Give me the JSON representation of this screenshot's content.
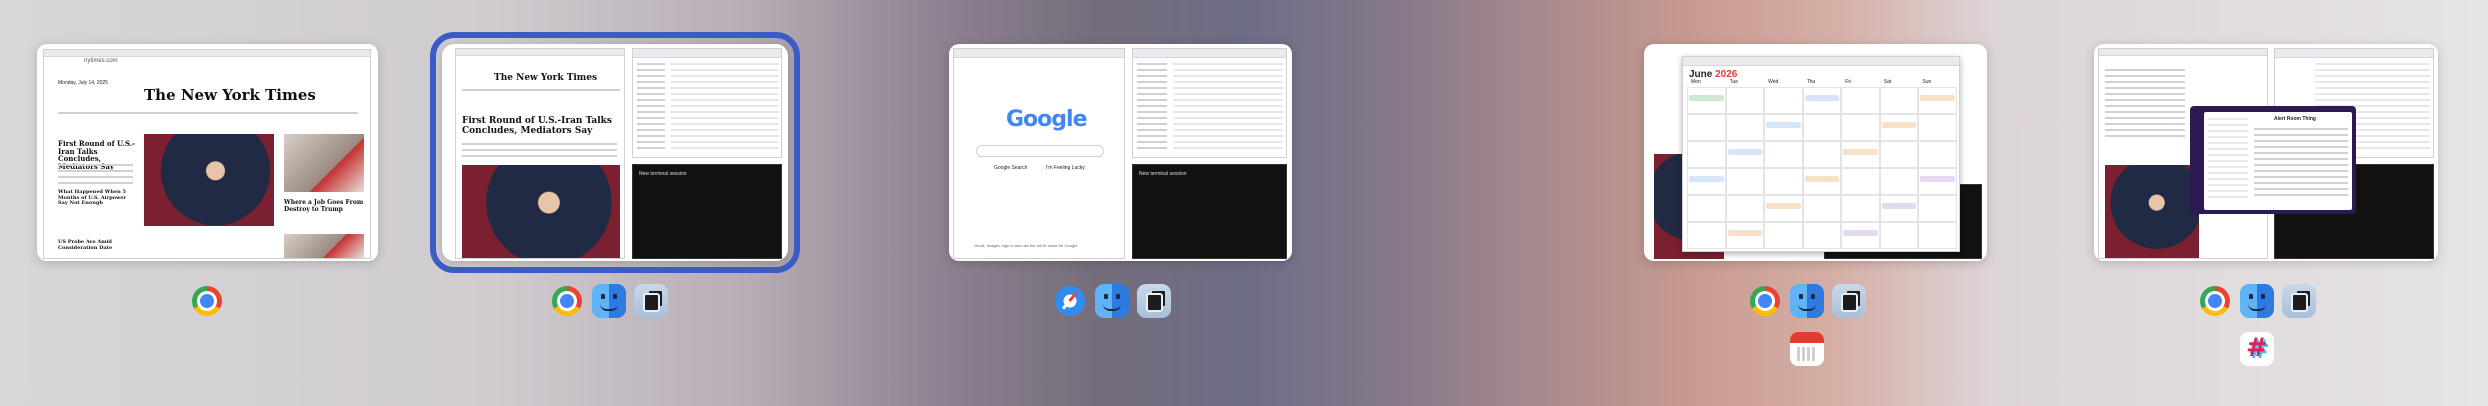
{
  "spaces": [
    {
      "id": "space-1",
      "windows": {
        "nyt_url": "nytimes.com",
        "nyt_date": "Monday, July 14, 2025",
        "nyt_logo": "The New York Times",
        "nyt_headline_1": "First Round of U.S.-Iran Talks Concludes, Mediators Say",
        "nyt_headline_2": "What Happened When 5 Months of U.S. Airpower Say Not Enough",
        "nyt_headline_3": "Where a Job Goes From Destroy to Trump",
        "nyt_headline_4": "US Probe Ave Amid Consideration Date"
      },
      "apps": [
        "chrome-icon"
      ]
    },
    {
      "id": "space-2",
      "selected": true,
      "windows": {
        "nyt_logo": "The New York Times",
        "nyt_headline": "First Round of U.S.-Iran Talks Concludes, Mediators Say",
        "terminal_text": "New terminal session"
      },
      "apps": [
        "chrome-icon",
        "finder-icon",
        "terminal-icon"
      ]
    },
    {
      "id": "space-3",
      "windows": {
        "google_logo": "Google",
        "google_btn_1": "Google Search",
        "google_btn_2": "I'm Feeling Lucky",
        "google_footer": "Gmail, Images; sign in and use the full AI mode for Google",
        "terminal_text": "New terminal session"
      },
      "apps": [
        "safari-icon",
        "finder-icon",
        "terminal-icon"
      ]
    },
    {
      "id": "space-4",
      "windows": {
        "calendar_month": "June",
        "calendar_year": "2026",
        "days": [
          "Mon",
          "Tue",
          "Wed",
          "Thu",
          "Fri",
          "Sat",
          "Sun"
        ]
      },
      "apps": [
        "chrome-icon",
        "finder-icon",
        "terminal-icon"
      ],
      "apps_row2": [
        "fantastical-icon"
      ]
    },
    {
      "id": "space-5",
      "windows": {
        "slack_title": "Alert Room Thing"
      },
      "apps": [
        "chrome-icon",
        "finder-icon",
        "terminal-icon"
      ],
      "apps_row2": [
        "slack-icon"
      ]
    }
  ]
}
